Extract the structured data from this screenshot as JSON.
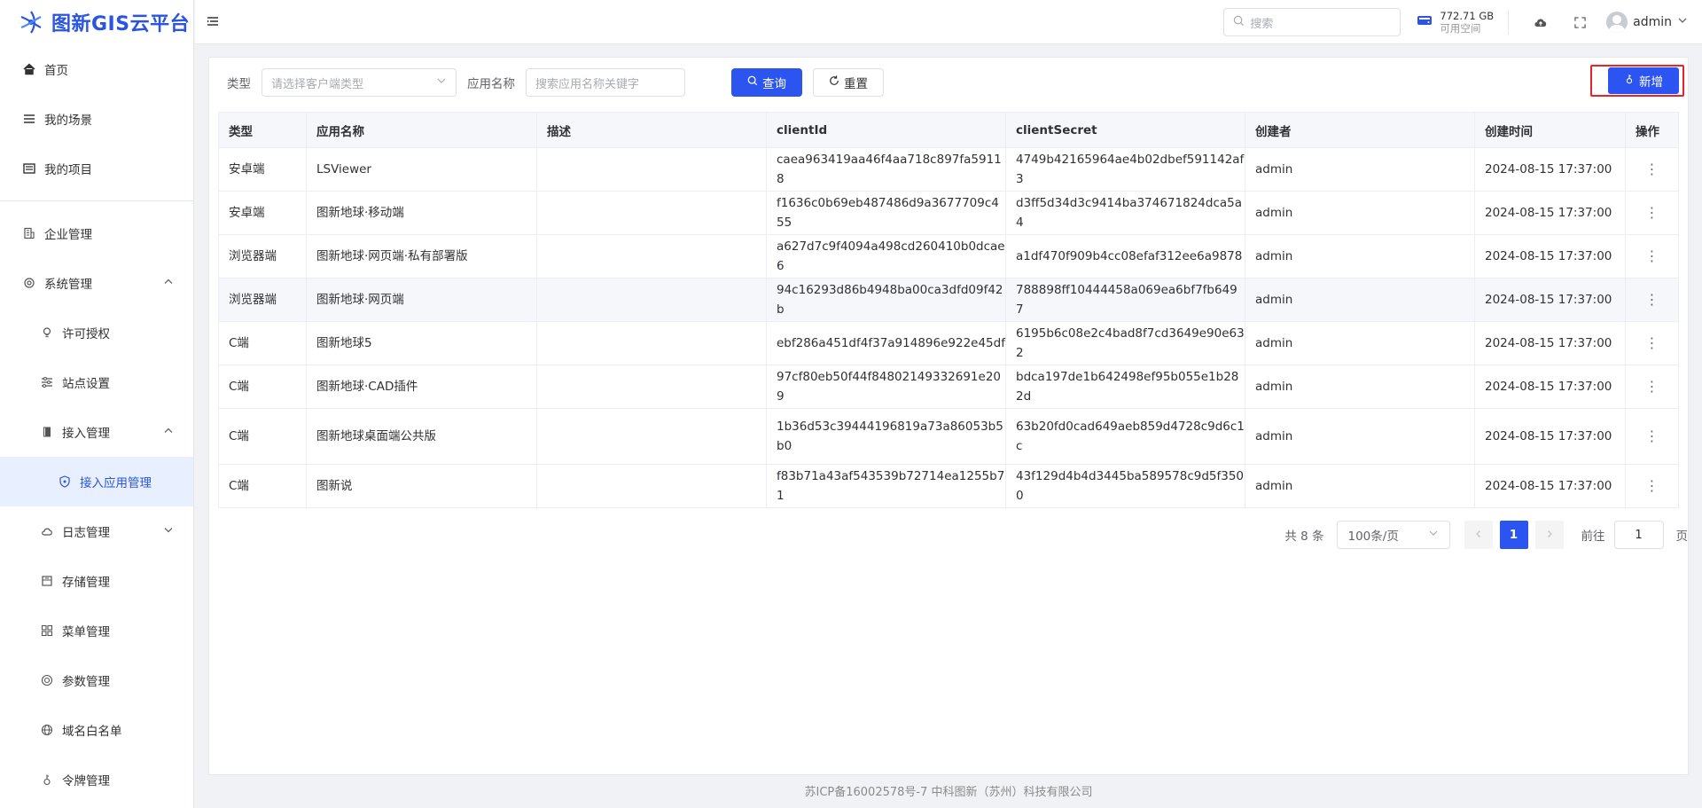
{
  "app": {
    "title": "图新GIS云平台"
  },
  "sidebar": {
    "items": [
      {
        "label": "首页",
        "icon": "home-icon"
      },
      {
        "label": "我的场景",
        "icon": "list-icon"
      },
      {
        "label": "我的项目",
        "icon": "folder-icon"
      },
      {
        "label": "企业管理",
        "icon": "building-icon"
      },
      {
        "label": "系统管理",
        "icon": "gear-icon"
      },
      {
        "label": "许可授权",
        "icon": "bulb-icon"
      },
      {
        "label": "站点设置",
        "icon": "sliders-icon"
      },
      {
        "label": "接入管理",
        "icon": "book-icon"
      },
      {
        "label": "接入应用管理",
        "icon": "shield-icon"
      },
      {
        "label": "日志管理",
        "icon": "cloud-icon"
      },
      {
        "label": "存储管理",
        "icon": "storage-icon"
      },
      {
        "label": "菜单管理",
        "icon": "grid-icon"
      },
      {
        "label": "参数管理",
        "icon": "target-icon"
      },
      {
        "label": "域名白名单",
        "icon": "globe-icon"
      },
      {
        "label": "令牌管理",
        "icon": "token-icon"
      }
    ]
  },
  "header": {
    "search_placeholder": "搜索",
    "storage_size": "772.71 GB",
    "storage_label": "可用空间",
    "username": "admin"
  },
  "filters": {
    "type_label": "类型",
    "type_placeholder": "请选择客户端类型",
    "name_label": "应用名称",
    "name_placeholder": "搜索应用名称关键字",
    "query_label": "查询",
    "reset_label": "重置",
    "add_label": "新增"
  },
  "table": {
    "headers": [
      "类型",
      "应用名称",
      "描述",
      "clientId",
      "clientSecret",
      "创建者",
      "创建时间",
      "操作"
    ],
    "rows": [
      {
        "type": "安卓端",
        "name": "LSViewer",
        "desc": "",
        "clientId": "caea963419aa46f4aa718c897fa59118",
        "clientSecret": "4749b42165964ae4b02dbef591142af3",
        "creator": "admin",
        "created": "2024-08-15 17:37:00"
      },
      {
        "type": "安卓端",
        "name": "图新地球·移动端",
        "desc": "",
        "clientId": "f1636c0b69eb487486d9a3677709c455",
        "clientSecret": "d3ff5d34d3c9414ba374671824dca5a4",
        "creator": "admin",
        "created": "2024-08-15 17:37:00"
      },
      {
        "type": "浏览器端",
        "name": "图新地球·网页端·私有部署版",
        "desc": "",
        "clientId": "a627d7c9f4094a498cd260410b0dcae6",
        "clientSecret": "a1df470f909b4cc08efaf312ee6a9878",
        "creator": "admin",
        "created": "2024-08-15 17:37:00"
      },
      {
        "type": "浏览器端",
        "name": "图新地球·网页端",
        "desc": "",
        "clientId": "94c16293d86b4948ba00ca3dfd09f42b",
        "clientSecret": "788898ff10444458a069ea6bf7fb6497",
        "creator": "admin",
        "created": "2024-08-15 17:37:00"
      },
      {
        "type": "C端",
        "name": "图新地球5",
        "desc": "",
        "clientId": "ebf286a451df4f37a914896e922e45df",
        "clientSecret": "6195b6c08e2c4bad8f7cd3649e90e632",
        "creator": "admin",
        "created": "2024-08-15 17:37:00"
      },
      {
        "type": "C端",
        "name": "图新地球·CAD插件",
        "desc": "",
        "clientId": "97cf80eb50f44f84802149332691e209",
        "clientSecret": "bdca197de1b642498ef95b055e1b282d",
        "creator": "admin",
        "created": "2024-08-15 17:37:00"
      },
      {
        "type": "C端",
        "name": "图新地球桌面端公共版",
        "desc": "",
        "clientId": "1b36d53c39444196819a73a86053b5b0",
        "clientSecret": "63b20fd0cad649aeb859d4728c9d6c1c",
        "creator": "admin",
        "created": "2024-08-15 17:37:00"
      },
      {
        "type": "C端",
        "name": "图新说",
        "desc": "",
        "clientId": "f83b71a43af543539b72714ea1255b71",
        "clientSecret": "43f129d4b4d3445ba589578c9d5f3500",
        "creator": "admin",
        "created": "2024-08-15 17:37:00"
      }
    ]
  },
  "pagination": {
    "total": "共 8 条",
    "page_size": "100条/页",
    "current": "1",
    "goto_label": "前往",
    "goto_value": "1",
    "page_suffix": "页"
  },
  "footer": {
    "text": "苏ICP备16002578号-7 中科图新（苏州）科技有限公司"
  },
  "colors": {
    "primary": "#2b54f0",
    "highlight_border": "#e8232b",
    "active_bg": "#e8effe"
  }
}
